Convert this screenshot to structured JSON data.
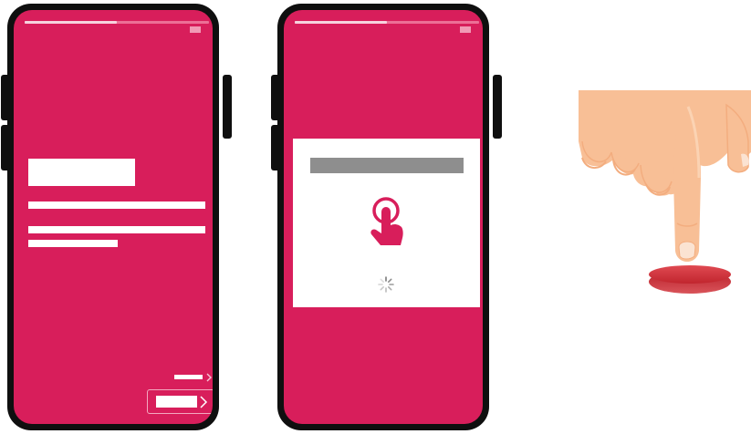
{
  "scene": {
    "phones": [
      {
        "screen_color": "#d81e5b",
        "progress": 0.5,
        "view": "intro",
        "back_link_icon": "chevron-right-icon",
        "next_button_icon": "chevron-right-icon"
      },
      {
        "screen_color": "#d81e5b",
        "progress": 0.5,
        "view": "loading-dialog",
        "dialog_icon": "tap-hand-icon",
        "status_icon": "loading-spinner-icon"
      }
    ],
    "illustration": {
      "subject": "finger-pressing-button",
      "skin_color": "#f8bf96",
      "button_color": "#c8242f"
    }
  }
}
